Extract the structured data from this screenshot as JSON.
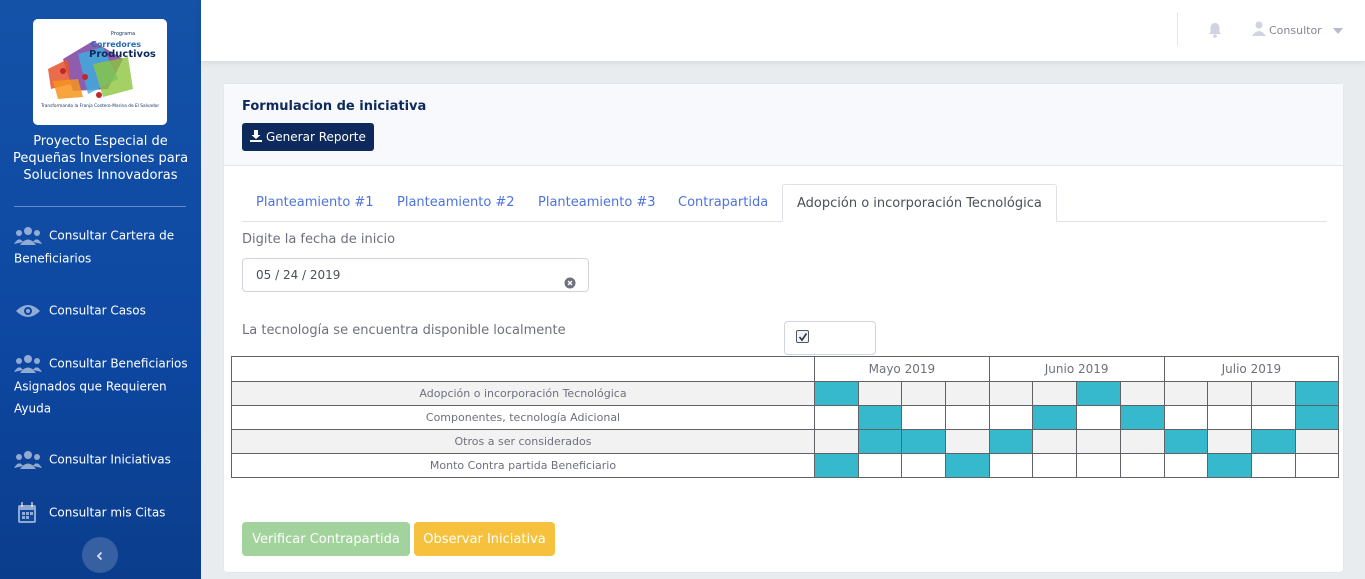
{
  "sidebar": {
    "logo": {
      "small_text": "Programa",
      "line1": "Corredores",
      "line2": "Productivos",
      "tagline": "Transformando la Franja Costero-Marina de El Salvador"
    },
    "brand_line1": "Proyecto Especial de",
    "brand_line2": "Pequeñas Inversiones para",
    "brand_line3": "Soluciones Innovadoras",
    "items": [
      {
        "label": "Consultar Cartera de Beneficiarios",
        "icon": "users-icon"
      },
      {
        "label": "Consultar Casos",
        "icon": "eye-icon"
      },
      {
        "label": "Consultar Beneficiarios Asignados que Requieren Ayuda",
        "icon": "users-icon"
      },
      {
        "label": "Consultar Iniciativas",
        "icon": "users-icon"
      },
      {
        "label": "Consultar mis Citas",
        "icon": "calendar-icon"
      }
    ]
  },
  "topbar": {
    "user_name": "Consultor"
  },
  "card": {
    "title": "Formulacion de iniciativa",
    "report_button": "Generar Reporte"
  },
  "tabs": [
    {
      "label": "Planteamiento #1",
      "active": false
    },
    {
      "label": "Planteamiento #2",
      "active": false
    },
    {
      "label": "Planteamiento #3",
      "active": false
    },
    {
      "label": "Contrapartida",
      "active": false
    },
    {
      "label": "Adopción o incorporación Tecnológica",
      "active": true
    }
  ],
  "form": {
    "date_label": "Digite la fecha de inicio",
    "date_value": "05 / 24 / 2019",
    "tech_label": "La tecnología se encuentra disponible localmente",
    "tech_checked": true
  },
  "schedule": {
    "months": [
      "Mayo 2019",
      "Junio 2019",
      "Julio 2019"
    ],
    "weeks_per_month": 4,
    "rows": [
      {
        "label": "Adopción o incorporación Tecnológica",
        "cells": [
          1,
          0,
          0,
          0,
          0,
          0,
          1,
          0,
          0,
          0,
          0,
          1
        ]
      },
      {
        "label": "Componentes, tecnología Adicional",
        "cells": [
          0,
          1,
          0,
          0,
          0,
          1,
          0,
          1,
          0,
          0,
          0,
          1
        ]
      },
      {
        "label": "Otros a ser considerados",
        "cells": [
          0,
          1,
          1,
          0,
          1,
          0,
          0,
          0,
          1,
          0,
          1,
          0
        ]
      },
      {
        "label": "Monto Contra partida Beneficiario",
        "cells": [
          1,
          0,
          0,
          1,
          0,
          0,
          0,
          0,
          0,
          1,
          0,
          0
        ]
      }
    ],
    "highlight_color": "#36b9cc"
  },
  "actions": {
    "verify_label": "Verificar Contrapartida",
    "observe_label": "Observar Iniciativa"
  },
  "colors": {
    "sidebar": "#0d47a1",
    "primary_dark": "#0e2a5c",
    "tab_link": "#4e73df",
    "verify": "#a3d39c",
    "observe": "#f6c23e"
  }
}
